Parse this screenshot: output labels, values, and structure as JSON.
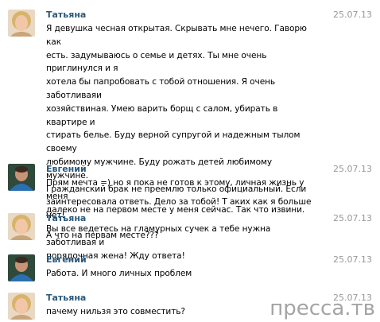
{
  "messages": [
    {
      "author": "Татьяна",
      "date": "25.07.13",
      "avatar": "female-avatar",
      "text": "Я девушка чесная открытая. Скрывать мне нечего. Гаворю как\nесть. задумываюсь о семье и детях. Ты мне очень приглинулся и я\nхотела бы папробовать с тобой отношения. Я очень заботливаяи\nхозяйствиная. Умею варить борщ с салом, убирать в квартире и\nстирать белье. Буду верной супругой и надежным тылом своему\nлюбимому мужчине. Буду рожать детей любимому мужчине.\nГражданский брак не преемлю только официальный. Если\nзаинтересовала ответь. Дело за тобой! Т аких как я больше нет!\nВы все ведетесь на гламурных сучек а тебе нужна заботливая и\nпорядочная жена! Жду ответа!"
    },
    {
      "author": "Евгений",
      "date": "25.07.13",
      "avatar": "male-avatar",
      "text": "Прям мечта =) но я пока не готов к этому, личная жизнь у меня\nдалеко не на первом месте у меня сейчас. Так что извини."
    },
    {
      "author": "Татьяна",
      "date": "25.07.13",
      "avatar": "female-avatar",
      "text": "А что на первам месте???"
    },
    {
      "author": "Евгений",
      "date": "25.07.13",
      "avatar": "male-avatar",
      "text": "Работа. И много личных проблем"
    },
    {
      "author": "Татьяна",
      "date": "25.07.13",
      "avatar": "female-avatar",
      "text": "пачему нильзя это совместить?"
    }
  ],
  "watermark": "пресса.тв",
  "colors": {
    "author": "#2b587a",
    "date": "#999999",
    "background": "#ffffff"
  }
}
